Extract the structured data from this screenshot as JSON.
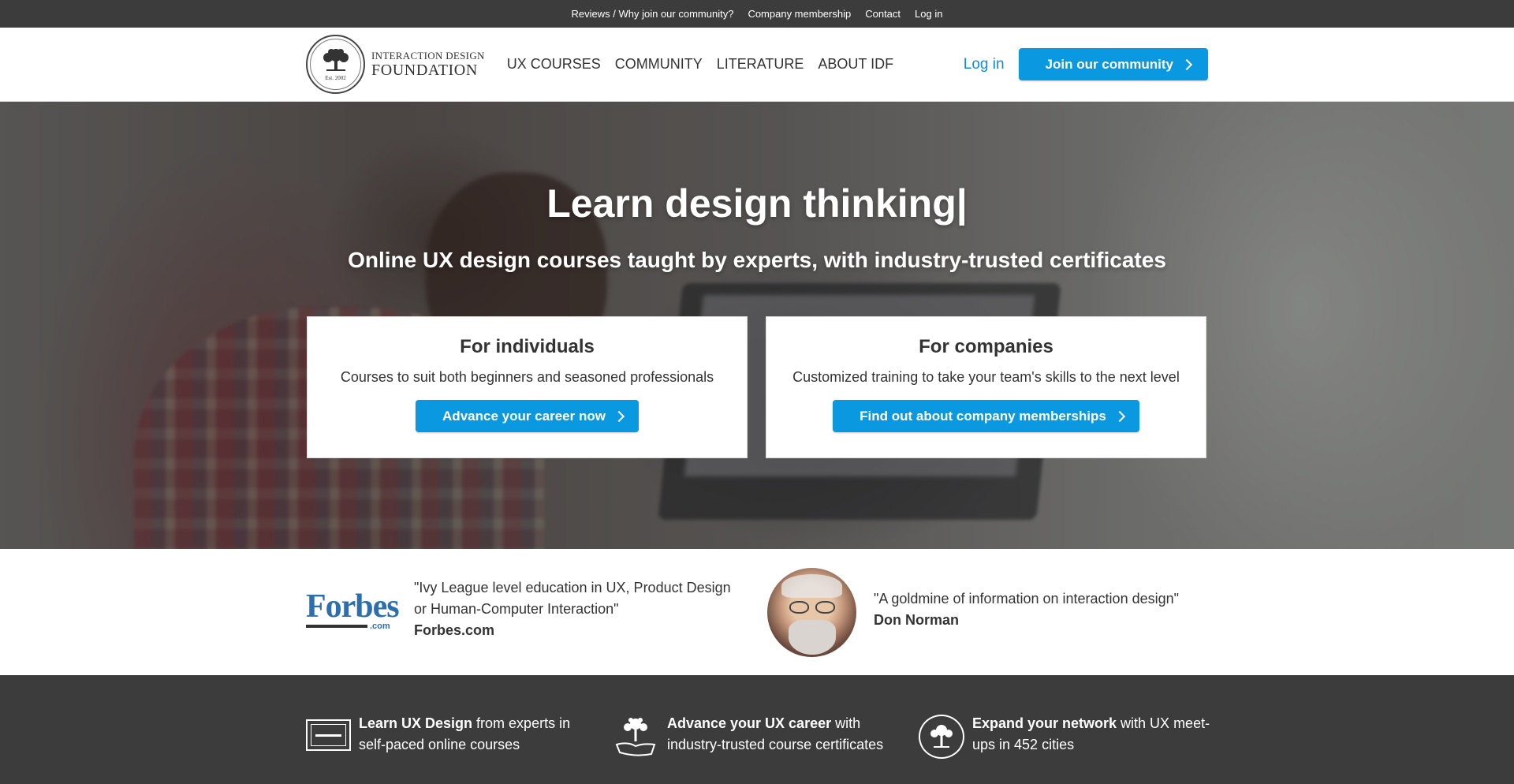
{
  "topbar": {
    "links": [
      "Reviews / Why join our community?",
      "Company membership",
      "Contact",
      "Log in"
    ]
  },
  "header": {
    "logo_line1": "INTERACTION DESIGN",
    "logo_line2": "FOUNDATION",
    "logo_est": "Est. 2002",
    "nav": [
      "UX COURSES",
      "COMMUNITY",
      "LITERATURE",
      "ABOUT IDF"
    ],
    "login_label": "Log in",
    "join_label": "Join our community"
  },
  "hero": {
    "title": "Learn design thinking|",
    "subtitle": "Online UX design courses taught by experts, with industry-trusted certificates",
    "cards": [
      {
        "title": "For individuals",
        "text": "Courses to suit both beginners and seasoned professionals",
        "button": "Advance your career now"
      },
      {
        "title": "For companies",
        "text": "Customized training to take your team's skills to the next level",
        "button": "Find out about company memberships"
      }
    ]
  },
  "testimonials": {
    "forbes_logo_text": "Forbes",
    "forbes_logo_sub": ".com",
    "forbes_quote": "\"Ivy League level education in UX, Product Design or Human-Computer Interaction\"",
    "forbes_author": "Forbes.com",
    "norman_quote": "\"A goldmine of information on interaction design\"",
    "norman_author": "Don Norman"
  },
  "features": [
    {
      "bold": "Learn UX Design",
      "rest": " from experts in self-paced online courses",
      "icon": "certificate-icon"
    },
    {
      "bold": "Advance your UX career",
      "rest": " with industry-trusted course certificates",
      "icon": "tree-hand-icon"
    },
    {
      "bold": "Expand your network",
      "rest": " with UX meet-ups in 452 cities",
      "icon": "tree-circle-icon"
    }
  ],
  "colors": {
    "accent": "#0a98e0",
    "link": "#0a8fd8",
    "dark_bar": "#3c3c3c",
    "forbes_blue": "#2d6fae"
  }
}
